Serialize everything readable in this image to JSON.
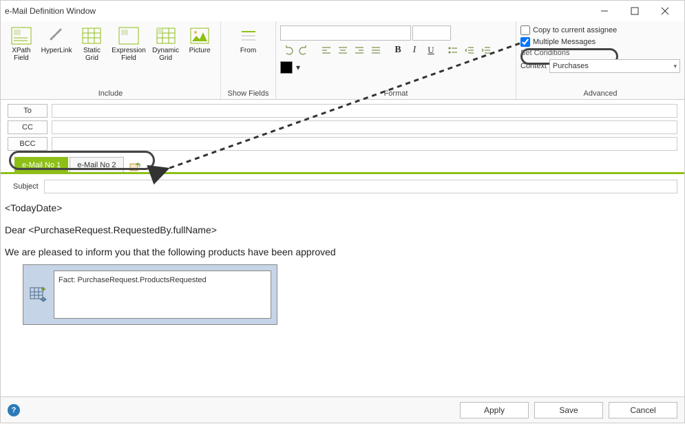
{
  "window": {
    "title": "e-Mail Definition Window"
  },
  "ribbon": {
    "include": {
      "label": "Include",
      "xpath_field": "XPath\nField",
      "hyperlink": "HyperLink",
      "static_grid": "Static\nGrid",
      "expression_field": "Expression\nField",
      "dynamic_grid": "Dynamic\nGrid",
      "picture": "Picture"
    },
    "show_fields": {
      "label": "Show Fields",
      "from": "From"
    },
    "format": {
      "label": "Format"
    },
    "advanced": {
      "label": "Advanced",
      "copy_assignee": "Copy to current assignee",
      "multiple_messages": "Multiple Messages",
      "set_conditions": "Set Conditions",
      "context_label": "Context",
      "context_value": "Purchases"
    }
  },
  "fields": {
    "to": "To",
    "cc": "CC",
    "bcc": "BCC",
    "subject": "Subject"
  },
  "tabs": {
    "t1": "e-Mail No  1",
    "t2": "e-Mail No  2"
  },
  "body": {
    "line1": "<TodayDate>",
    "line2": "Dear <PurchaseRequest.RequestedBy.fullName>",
    "line3": "We are pleased to inform you that the following products have been approved",
    "fact_label": "Fact: PurchaseRequest.ProductsRequested"
  },
  "footer": {
    "apply": "Apply",
    "save": "Save",
    "cancel": "Cancel"
  }
}
